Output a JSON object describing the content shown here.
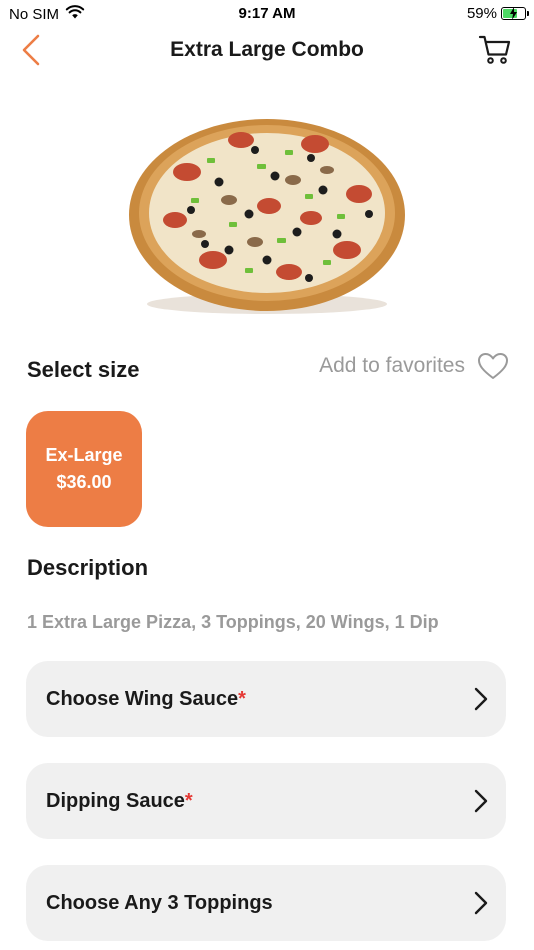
{
  "status_bar": {
    "carrier": "No SIM",
    "time": "9:17 AM",
    "battery_percent": "59%",
    "battery_level": 0.59
  },
  "nav": {
    "title": "Extra Large Combo",
    "back_icon": "chevron-left-icon",
    "cart_icon": "cart-icon"
  },
  "colors": {
    "accent": "#ed7d45",
    "required": "#e53935",
    "muted_text": "#9a9a9a",
    "row_bg": "#f0f0f0"
  },
  "size_section": {
    "heading": "Select size",
    "favorites_label": "Add to favorites",
    "favorites_icon": "heart-outline-icon",
    "options": [
      {
        "name": "Ex-Large",
        "price": "$36.00",
        "selected": true
      }
    ]
  },
  "description": {
    "heading": "Description",
    "text": "1 Extra Large Pizza, 3 Toppings, 20 Wings, 1 Dip"
  },
  "options": [
    {
      "label": "Choose Wing Sauce",
      "required_mark": "*"
    },
    {
      "label": "Dipping Sauce",
      "required_mark": "*"
    },
    {
      "label": "Choose Any 3 Toppings",
      "required_mark": ""
    }
  ]
}
